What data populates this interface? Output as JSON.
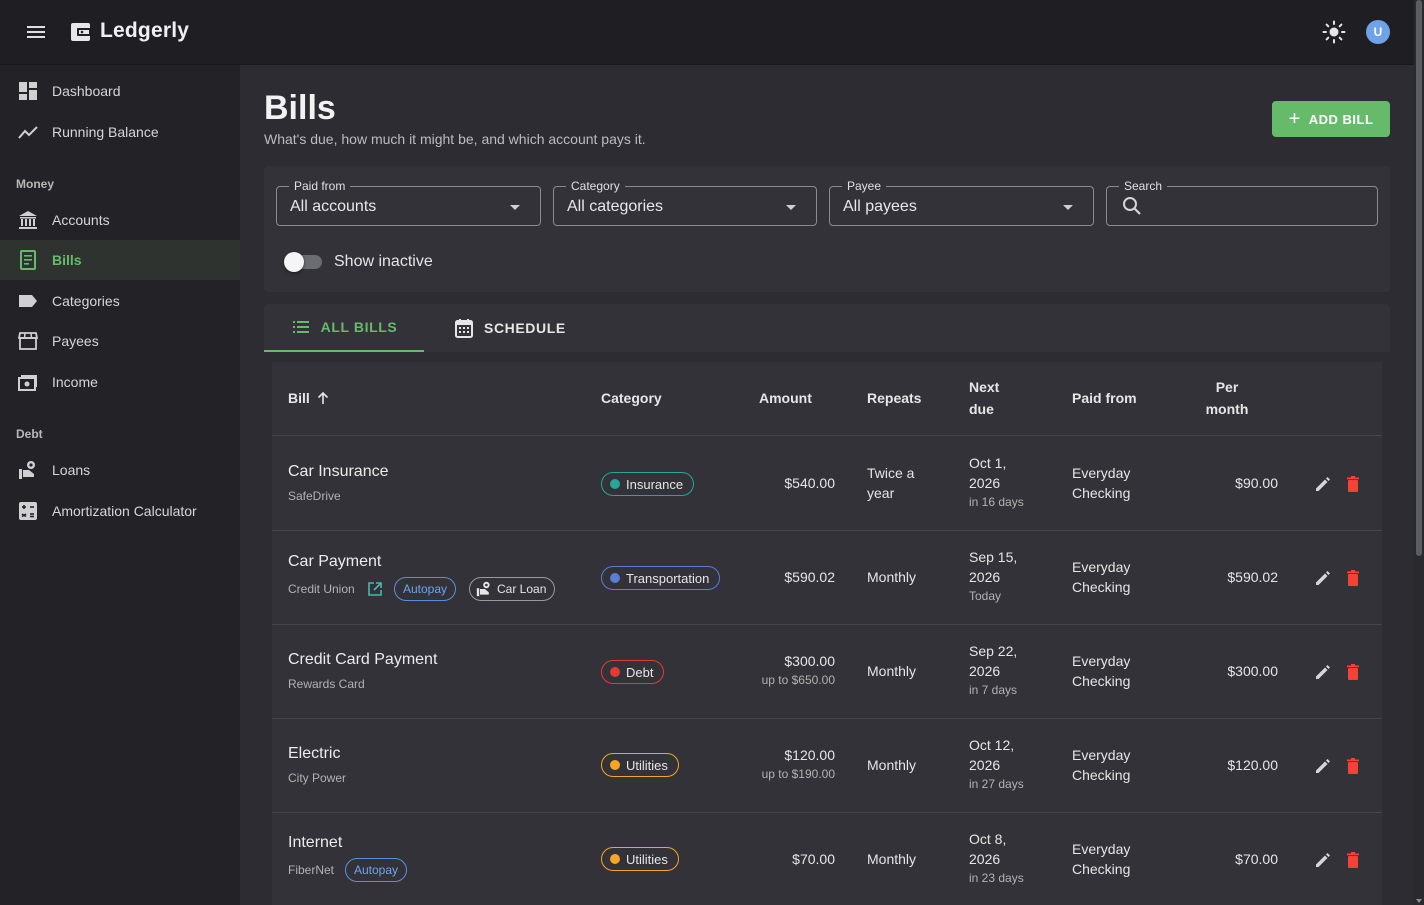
{
  "app": {
    "brand": "Ledgerly",
    "avatar_letter": "U"
  },
  "sidebar": {
    "items": [
      {
        "label": "Dashboard",
        "icon": "dashboard-icon"
      },
      {
        "label": "Running Balance",
        "icon": "trend-line-icon"
      }
    ],
    "sections": [
      {
        "title": "Money",
        "items": [
          {
            "label": "Accounts",
            "icon": "bank-icon"
          },
          {
            "label": "Bills",
            "icon": "receipt-icon",
            "active": true
          },
          {
            "label": "Categories",
            "icon": "label-icon"
          },
          {
            "label": "Payees",
            "icon": "storefront-icon"
          },
          {
            "label": "Income",
            "icon": "cash-icon"
          }
        ]
      },
      {
        "title": "Debt",
        "items": [
          {
            "label": "Loans",
            "icon": "hand-coin-icon"
          },
          {
            "label": "Amortization Calculator",
            "icon": "calculator-icon"
          }
        ]
      }
    ]
  },
  "page": {
    "title": "Bills",
    "subtitle": "What's due, how much it might be, and which account pays it.",
    "add_button": "ADD BILL"
  },
  "filters": {
    "paid_from": {
      "label": "Paid from",
      "value": "All accounts"
    },
    "category": {
      "label": "Category",
      "value": "All categories"
    },
    "payee": {
      "label": "Payee",
      "value": "All payees"
    },
    "search": {
      "label": "Search",
      "value": ""
    },
    "show_inactive": {
      "label": "Show inactive",
      "checked": false
    }
  },
  "tabs": [
    {
      "label": "ALL BILLS",
      "icon": "list-icon",
      "active": true
    },
    {
      "label": "SCHEDULE",
      "icon": "calendar-icon",
      "active": false
    }
  ],
  "table": {
    "headers": {
      "bill": "Bill",
      "category": "Category",
      "amount": "Amount",
      "repeats": "Repeats",
      "next_due_1": "Next",
      "next_due_2": "due",
      "paid_from": "Paid from",
      "per_month_1": "Per",
      "per_month_2": "month"
    },
    "rows": [
      {
        "name": "Car Insurance",
        "payee": "SafeDrive",
        "category": "Insurance",
        "category_color": "#26a69a",
        "amount": "$540.00",
        "amount_upto": "",
        "repeats_1": "Twice a",
        "repeats_2": "year",
        "due_1": "Oct 1,",
        "due_2": "2026",
        "due_rel": "in 16 days",
        "paid_1": "Everyday",
        "paid_2": "Checking",
        "per_month": "$90.00"
      },
      {
        "name": "Car Payment",
        "payee": "Credit Union",
        "autopay": "Autopay",
        "loan": "Car Loan",
        "category": "Transportation",
        "category_color": "#5c7cd6",
        "amount": "$590.02",
        "amount_upto": "",
        "repeats_1": "Monthly",
        "repeats_2": "",
        "due_1": "Sep 15,",
        "due_2": "2026",
        "due_rel": "Today",
        "paid_1": "Everyday",
        "paid_2": "Checking",
        "per_month": "$590.02"
      },
      {
        "name": "Credit Card Payment",
        "payee": "Rewards Card",
        "category": "Debt",
        "category_color": "#e53935",
        "amount": "$300.00",
        "amount_upto": "up to $650.00",
        "repeats_1": "Monthly",
        "repeats_2": "",
        "due_1": "Sep 22,",
        "due_2": "2026",
        "due_rel": "in 7 days",
        "paid_1": "Everyday",
        "paid_2": "Checking",
        "per_month": "$300.00"
      },
      {
        "name": "Electric",
        "payee": "City Power",
        "category": "Utilities",
        "category_color": "#f5a623",
        "amount": "$120.00",
        "amount_upto": "up to $190.00",
        "repeats_1": "Monthly",
        "repeats_2": "",
        "due_1": "Oct 12,",
        "due_2": "2026",
        "due_rel": "in 27 days",
        "paid_1": "Everyday",
        "paid_2": "Checking",
        "per_month": "$120.00"
      },
      {
        "name": "Internet",
        "payee": "FiberNet",
        "autopay": "Autopay",
        "category": "Utilities",
        "category_color": "#f5a623",
        "amount": "$70.00",
        "amount_upto": "",
        "repeats_1": "Monthly",
        "repeats_2": "",
        "due_1": "Oct 8,",
        "due_2": "2026",
        "due_rel": "in 23 days",
        "paid_1": "Everyday",
        "paid_2": "Checking",
        "per_month": "$70.00"
      }
    ]
  },
  "colors": {
    "accent": "#66bb6a",
    "delete": "#f44336",
    "autopay": "#5a8fe0"
  }
}
